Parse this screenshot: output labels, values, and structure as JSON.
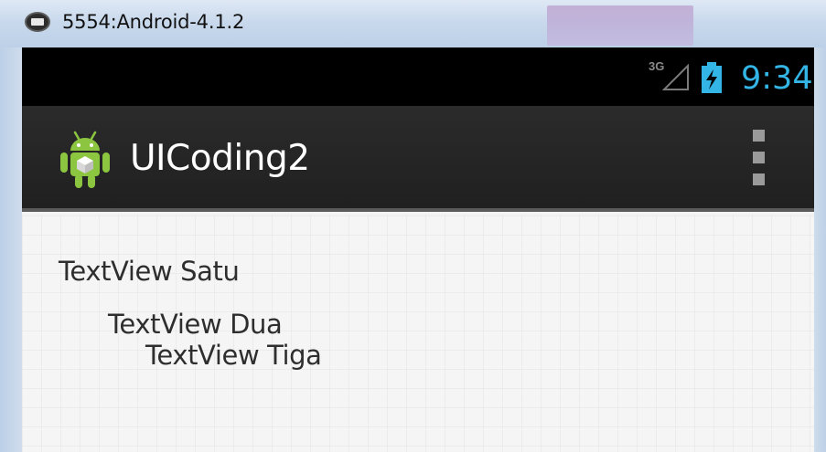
{
  "window": {
    "title": "5554:Android-4.1.2",
    "icon": "android-emulator-icon"
  },
  "status_bar": {
    "network_type": "3G",
    "signal_icon": "signal-strength-icon",
    "battery_icon": "battery-charging-icon",
    "time": "9:34",
    "time_color": "#33b5e5"
  },
  "action_bar": {
    "app_icon": "android-robot-icon",
    "app_title": "UICoding2",
    "overflow_icon": "overflow-menu-icon"
  },
  "content": {
    "textviews": [
      {
        "text": "TextView Satu"
      },
      {
        "text": "TextView Dua"
      },
      {
        "text": "TextView Tiga"
      }
    ]
  }
}
